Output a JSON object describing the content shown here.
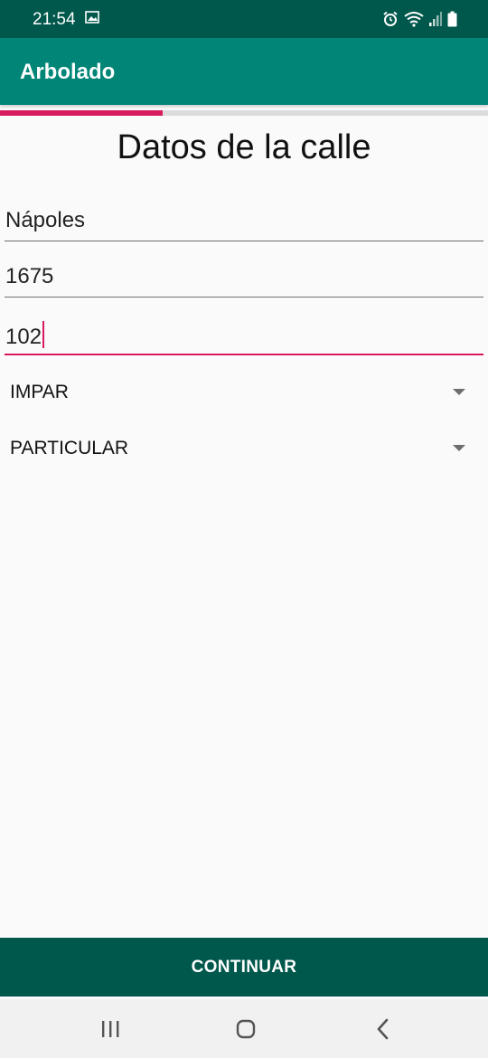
{
  "status_bar": {
    "time": "21:54",
    "icons": [
      "gallery-icon",
      "alarm-icon",
      "wifi-icon",
      "signal-icon",
      "battery-icon"
    ]
  },
  "app_bar": {
    "title": "Arbolado",
    "color": "#008577"
  },
  "progress": {
    "fraction": 0.333,
    "fill_color": "#d81b60",
    "track_color": "#dcdcdc"
  },
  "form": {
    "title": "Datos de la calle",
    "street_name": "Nápoles",
    "street_number": "1675",
    "third_value": "102",
    "parity_select": "IMPAR",
    "ownership_select": "PARTICULAR",
    "accent_color": "#d81b60"
  },
  "actions": {
    "continue_label": "CONTINUAR",
    "button_color": "#00574b"
  },
  "nav": {
    "icons": [
      "recent-apps-icon",
      "home-icon",
      "back-icon"
    ]
  }
}
